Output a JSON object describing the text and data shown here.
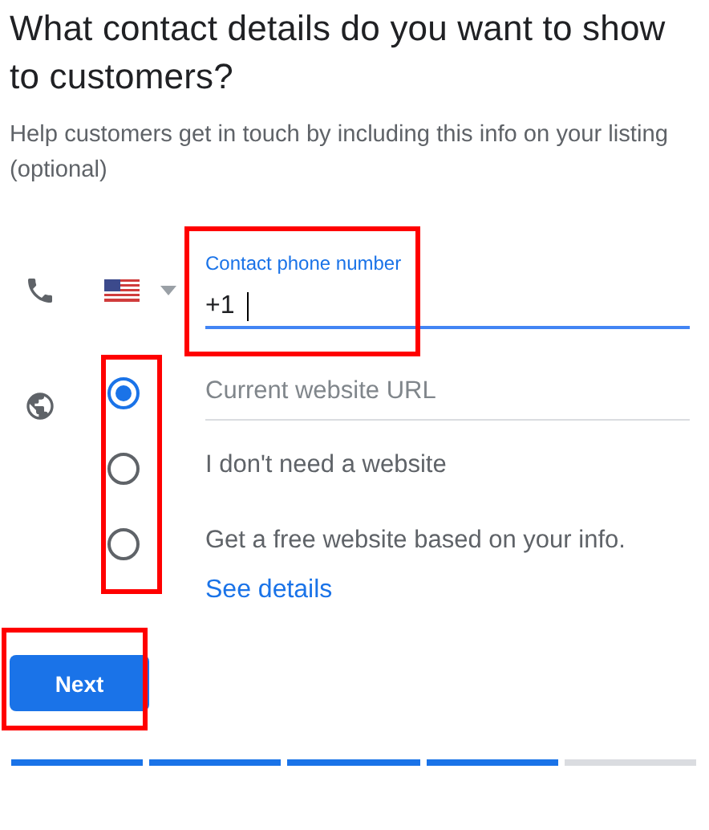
{
  "title": "What contact details do you want to show to customers?",
  "subtitle": "Help customers get in touch by including this info on your listing (optional)",
  "phone": {
    "label": "Contact phone number",
    "value": "+1",
    "focused": true,
    "highlighted": true
  },
  "website_options": {
    "highlighted": true,
    "options": [
      {
        "kind": "input",
        "placeholder": "Current website URL",
        "selected": true
      },
      {
        "kind": "text",
        "label": "I don't need a website",
        "selected": false
      },
      {
        "kind": "text",
        "label": "Get a free website based on your info.",
        "selected": false,
        "link": "See details"
      }
    ]
  },
  "next_button": {
    "label": "Next",
    "highlighted": true
  },
  "progress_steps": [
    {
      "completed": true
    },
    {
      "completed": true
    },
    {
      "completed": true
    },
    {
      "completed": true
    },
    {
      "completed": false
    }
  ]
}
